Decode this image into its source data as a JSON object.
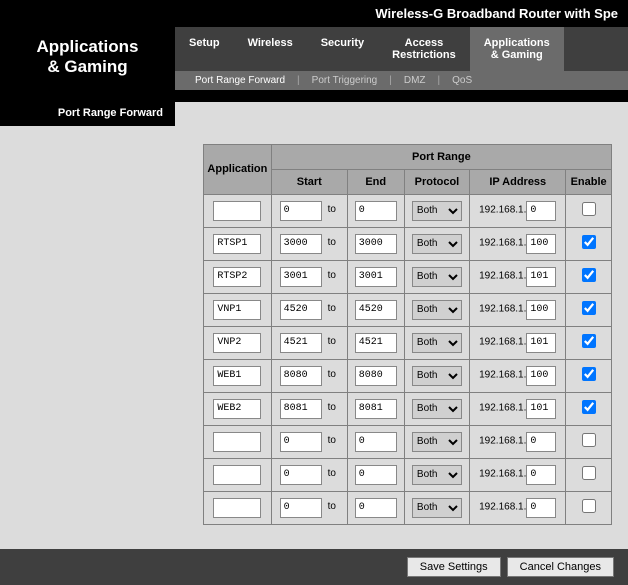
{
  "header": {
    "title": "Wireless-G Broadband Router with Spe"
  },
  "brand": {
    "line1": "Applications",
    "line2": "& Gaming"
  },
  "tabs": {
    "setup": "Setup",
    "wireless": "Wireless",
    "security": "Security",
    "access": "Access\nRestrictions",
    "apps": "Applications\n& Gaming"
  },
  "subtabs": {
    "prf": "Port Range Forward",
    "pt": "Port Triggering",
    "dmz": "DMZ",
    "qos": "QoS"
  },
  "page_label": "Port Range Forward",
  "table_title": "Port Range",
  "cols": {
    "app": "Application",
    "start": "Start",
    "end": "End",
    "proto": "Protocol",
    "ip": "IP Address",
    "enable": "Enable"
  },
  "to_label": "to",
  "ip_prefix": "192.168.1.",
  "proto_option": "Both",
  "rows": [
    {
      "app": "",
      "start": "0",
      "end": "0",
      "ip": "0",
      "enable": false
    },
    {
      "app": "RTSP1",
      "start": "3000",
      "end": "3000",
      "ip": "100",
      "enable": true
    },
    {
      "app": "RTSP2",
      "start": "3001",
      "end": "3001",
      "ip": "101",
      "enable": true
    },
    {
      "app": "VNP1",
      "start": "4520",
      "end": "4520",
      "ip": "100",
      "enable": true
    },
    {
      "app": "VNP2",
      "start": "4521",
      "end": "4521",
      "ip": "101",
      "enable": true
    },
    {
      "app": "WEB1",
      "start": "8080",
      "end": "8080",
      "ip": "100",
      "enable": true
    },
    {
      "app": "WEB2",
      "start": "8081",
      "end": "8081",
      "ip": "101",
      "enable": true
    },
    {
      "app": "",
      "start": "0",
      "end": "0",
      "ip": "0",
      "enable": false
    },
    {
      "app": "",
      "start": "0",
      "end": "0",
      "ip": "0",
      "enable": false
    },
    {
      "app": "",
      "start": "0",
      "end": "0",
      "ip": "0",
      "enable": false
    }
  ],
  "buttons": {
    "save": "Save Settings",
    "cancel": "Cancel Changes"
  }
}
